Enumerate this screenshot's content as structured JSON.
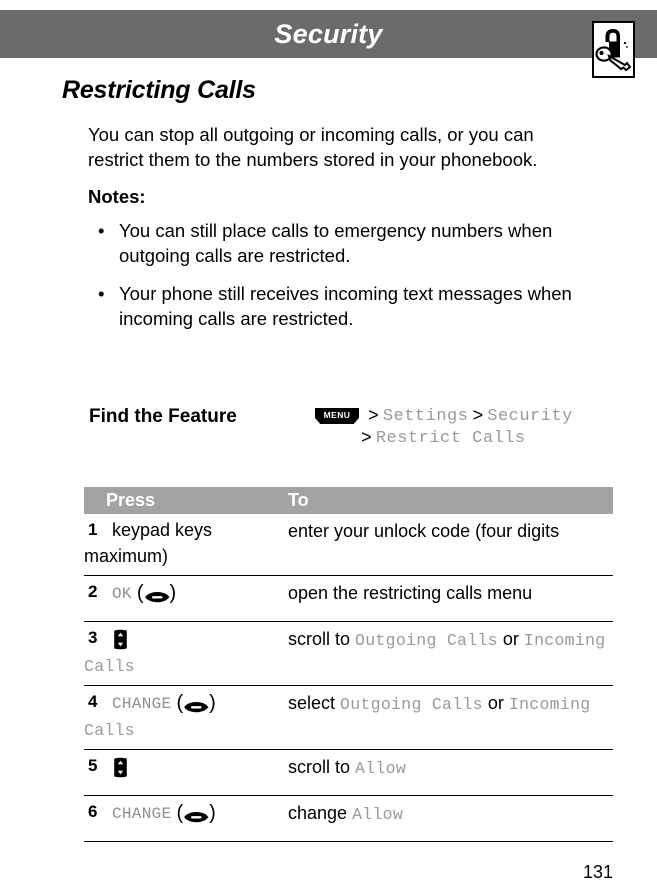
{
  "header": {
    "title": "Security",
    "icon": "padlock-and-key-icon"
  },
  "section": {
    "heading": "Restricting Calls",
    "intro": "You can stop all outgoing or incoming calls, or you can restrict them to the numbers stored in your phonebook.",
    "notes_label": "Notes:",
    "notes": [
      "You can still place calls to emergency numbers when outgoing calls are restricted.",
      "Your phone still receives incoming text messages when incoming calls are restricted."
    ]
  },
  "find_the_feature": {
    "label": "Find the Feature",
    "menu_badge": "MENU",
    "separator": ">",
    "path_line1": [
      "Settings",
      "Security"
    ],
    "path_line2": [
      "Restrict Calls"
    ]
  },
  "table": {
    "columns": [
      "Press",
      "To"
    ],
    "rows": [
      {
        "num": "1",
        "press_text": "keypad keys",
        "press_style": "plain",
        "press_icon": "none",
        "to_parts": [
          {
            "text": "enter your unlock code (four digits maximum)",
            "style": "plain"
          }
        ]
      },
      {
        "num": "2",
        "press_text": "OK",
        "press_style": "mono",
        "press_icon": "softkey-icon",
        "to_parts": [
          {
            "text": "open the restricting calls menu",
            "style": "plain"
          }
        ]
      },
      {
        "num": "3",
        "press_text": "",
        "press_style": "mono",
        "press_icon": "scrollkey-icon",
        "to_parts": [
          {
            "text": "scroll to ",
            "style": "plain"
          },
          {
            "text": "Outgoing Calls",
            "style": "mono"
          },
          {
            "text": " or ",
            "style": "plain"
          },
          {
            "text": "Incoming Calls",
            "style": "mono"
          }
        ]
      },
      {
        "num": "4",
        "press_text": "CHANGE",
        "press_style": "mono",
        "press_icon": "softkey-icon",
        "to_parts": [
          {
            "text": "select ",
            "style": "plain"
          },
          {
            "text": "Outgoing Calls",
            "style": "mono"
          },
          {
            "text": " or ",
            "style": "plain"
          },
          {
            "text": "Incoming Calls",
            "style": "mono"
          }
        ]
      },
      {
        "num": "5",
        "press_text": "",
        "press_style": "mono",
        "press_icon": "scrollkey-icon",
        "to_parts": [
          {
            "text": "scroll to ",
            "style": "plain"
          },
          {
            "text": "Allow",
            "style": "mono"
          }
        ]
      },
      {
        "num": "6",
        "press_text": "CHANGE",
        "press_style": "mono",
        "press_icon": "softkey-icon",
        "to_parts": [
          {
            "text": "change ",
            "style": "plain"
          },
          {
            "text": "Allow",
            "style": "mono"
          }
        ]
      }
    ]
  },
  "footer": {
    "page_number": "131"
  },
  "colors": {
    "header_band": "#6b6b6b",
    "table_header": "#a3a3a3",
    "mono_gray": "#9a9a9a",
    "text": "#000000"
  }
}
